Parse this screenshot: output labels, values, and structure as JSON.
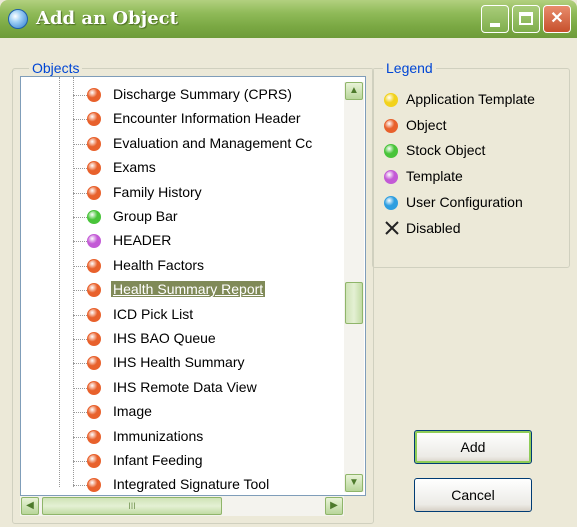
{
  "window": {
    "title": "Add an Object"
  },
  "objects_group": {
    "label": "Objects",
    "items": [
      {
        "label": "Discharge Summary (CPRS)",
        "type": "object"
      },
      {
        "label": "Encounter Information Header",
        "type": "object"
      },
      {
        "label": "Evaluation and Management Cc",
        "type": "object"
      },
      {
        "label": "Exams",
        "type": "object"
      },
      {
        "label": "Family History",
        "type": "object"
      },
      {
        "label": "Group Bar",
        "type": "stock"
      },
      {
        "label": "HEADER",
        "type": "template"
      },
      {
        "label": "Health Factors",
        "type": "object"
      },
      {
        "label": "Health Summary Report",
        "type": "object",
        "selected": true
      },
      {
        "label": "ICD Pick List",
        "type": "object"
      },
      {
        "label": "IHS BAO Queue",
        "type": "object"
      },
      {
        "label": "IHS Health Summary",
        "type": "object"
      },
      {
        "label": "IHS Remote Data View",
        "type": "object"
      },
      {
        "label": "Image",
        "type": "object"
      },
      {
        "label": "Immunizations",
        "type": "object"
      },
      {
        "label": "Infant Feeding",
        "type": "object"
      },
      {
        "label": "Integrated Signature Tool",
        "type": "object"
      }
    ],
    "hscroll_grip": "III"
  },
  "legend_group": {
    "label": "Legend",
    "items": [
      {
        "label": "Application Template",
        "type": "application"
      },
      {
        "label": "Object",
        "type": "object"
      },
      {
        "label": "Stock Object",
        "type": "stock"
      },
      {
        "label": "Template",
        "type": "template"
      },
      {
        "label": "User Configuration",
        "type": "user"
      },
      {
        "label": "Disabled",
        "type": "disabled"
      }
    ]
  },
  "buttons": {
    "add": "Add",
    "cancel": "Cancel"
  },
  "colors": {
    "application": "#f2d21c",
    "object": "#e8612c",
    "stock": "#49c43a",
    "template": "#c35ad6",
    "user": "#2e9ee0",
    "titlebar": "#8fba58"
  }
}
